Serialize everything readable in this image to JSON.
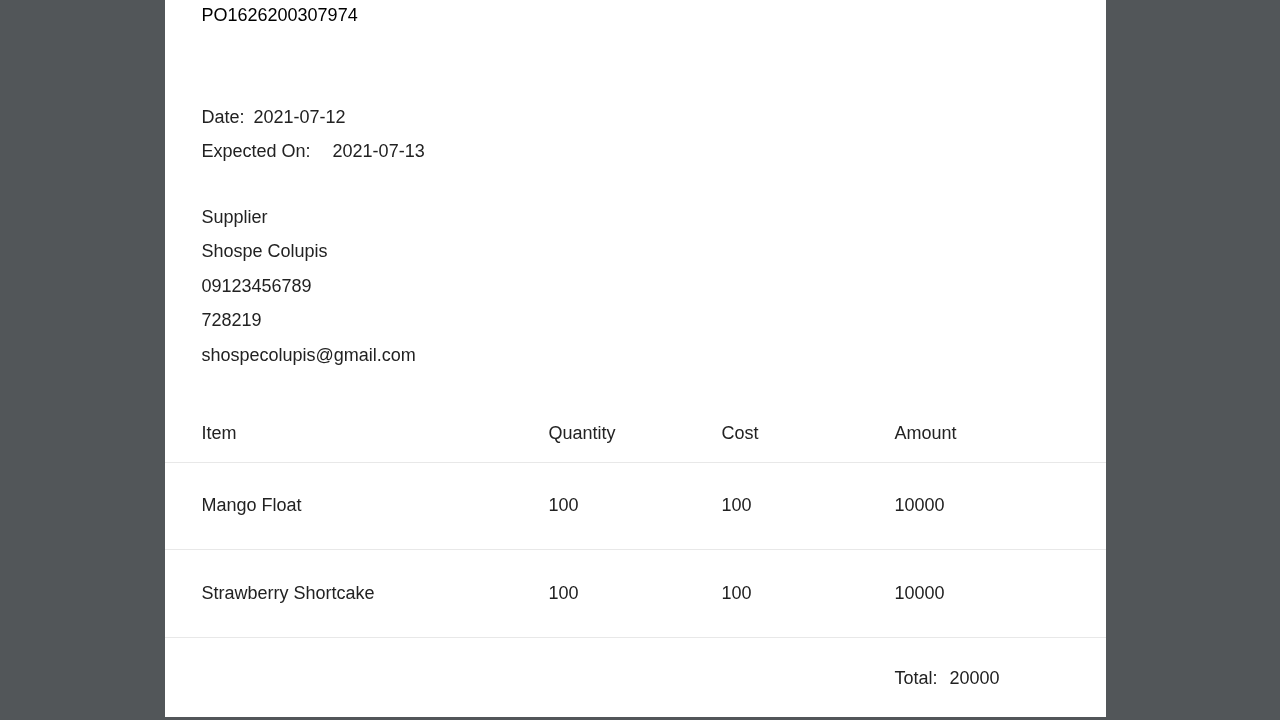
{
  "po_number": "PO1626200307974",
  "date": {
    "label": "Date:",
    "value": "2021-07-12"
  },
  "expected": {
    "label": "Expected On:",
    "value": "2021-07-13"
  },
  "supplier": {
    "heading": "Supplier",
    "lines": [
      "Shospe Colupis",
      "09123456789",
      "728219",
      "shospecolupis@gmail.com"
    ]
  },
  "table": {
    "columns": [
      "Item",
      "Quantity",
      "Cost",
      "Amount"
    ],
    "rows": [
      [
        "Mango Float",
        "100",
        "100",
        "10000"
      ],
      [
        "Strawberry Shortcake",
        "100",
        "100",
        "10000"
      ]
    ]
  },
  "total": {
    "label": "Total:",
    "value": "20000"
  }
}
